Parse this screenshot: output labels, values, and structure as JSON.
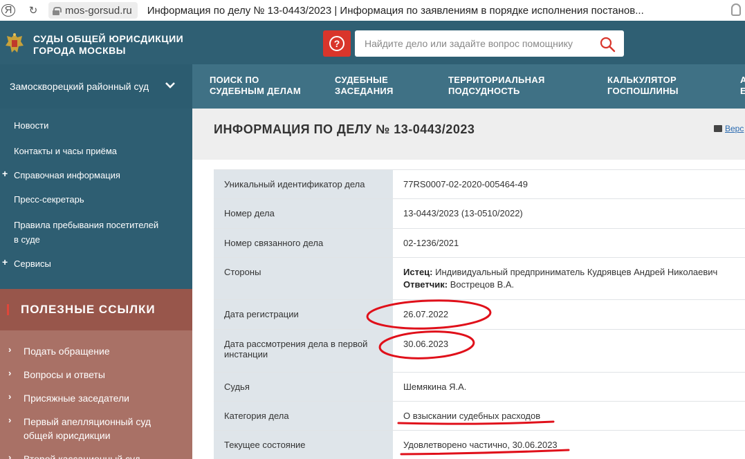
{
  "browser": {
    "url": "mos-gorsud.ru",
    "title": "Информация по делу № 13-0443/2023 | Информация по заявлениям в порядке исполнения постанов..."
  },
  "header": {
    "site_name_line1": "СУДЫ ОБЩЕЙ ЮРИСДИКЦИИ",
    "site_name_line2": "ГОРОДА МОСКВЫ",
    "help_symbol": "?",
    "search_placeholder": "Найдите дело или задайте вопрос помощнику"
  },
  "court_selector": "Замоскворецкий районный суд",
  "nav": {
    "items": [
      {
        "line1": "ПОИСК ПО",
        "line2": "СУДЕБНЫМ ДЕЛАМ"
      },
      {
        "line1": "СУДЕБНЫЕ",
        "line2": "ЗАСЕДАНИЯ"
      },
      {
        "line1": "ТЕРРИТОРИАЛЬНАЯ",
        "line2": "ПОДСУДНОСТЬ"
      },
      {
        "line1": "КАЛЬКУЛЯТОР",
        "line2": "ГОСПОШЛИНЫ"
      },
      {
        "line1": "А",
        "line2": "Е"
      }
    ]
  },
  "sidebar": {
    "items": [
      {
        "label": "Новости"
      },
      {
        "label": "Контакты и часы приёма"
      },
      {
        "label": "Справочная информация",
        "prefix": "+"
      },
      {
        "label": "Пресс-секретарь"
      },
      {
        "label": "Правила пребывания посетителей",
        "label2": "в суде"
      },
      {
        "label": "Сервисы",
        "prefix": "+"
      }
    ]
  },
  "useful_links": {
    "title": "ПОЛЕЗНЫЕ ССЫЛКИ",
    "arrow": "›",
    "items": [
      {
        "label": "Подать обращение"
      },
      {
        "label": "Вопросы и ответы"
      },
      {
        "label": "Присяжные заседатели"
      },
      {
        "label": "Первый апелляционный суд",
        "label2": "общей юрисдикции"
      },
      {
        "label": "Второй кассационный суд"
      }
    ]
  },
  "page": {
    "title": "ИНФОРМАЦИЯ ПО ДЕЛУ № 13-0443/2023",
    "print_label": "Верс"
  },
  "case_table": {
    "rows": [
      {
        "label": "Уникальный идентификатор дела",
        "value": "77RS0007-02-2020-005464-49"
      },
      {
        "label": "Номер дела",
        "value": "13-0443/2023 (13-0510/2022)"
      },
      {
        "label": "Номер связанного дела",
        "value": "02-1236/2021"
      },
      {
        "label": "Стороны",
        "plaintiff_label": "Истец:",
        "plaintiff": "Индивидуальный предприниматель Кудрявцев Андрей Николаевич",
        "defendant_label": "Ответчик:",
        "defendant": "Вострецов В.А."
      },
      {
        "label": "Дата регистрации",
        "value": "26.07.2022"
      },
      {
        "label": "Дата рассмотрения дела в первой",
        "label2": "инстанции",
        "value": "30.06.2023"
      },
      {
        "label": "Судья",
        "value": "Шемякина Я.А."
      },
      {
        "label": "Категория дела",
        "value": "О взыскании судебных расходов"
      },
      {
        "label": "Текущее состояние",
        "value": "Удовлетворено частично, 30.06.2023"
      }
    ]
  },
  "colors": {
    "header": "#2f5f73",
    "nav": "#3f7185",
    "sidebar": "#2e5e72",
    "links_head": "#98564b",
    "links": "#a97166",
    "help_button": "#d9352b",
    "annotation": "#e0101a"
  }
}
